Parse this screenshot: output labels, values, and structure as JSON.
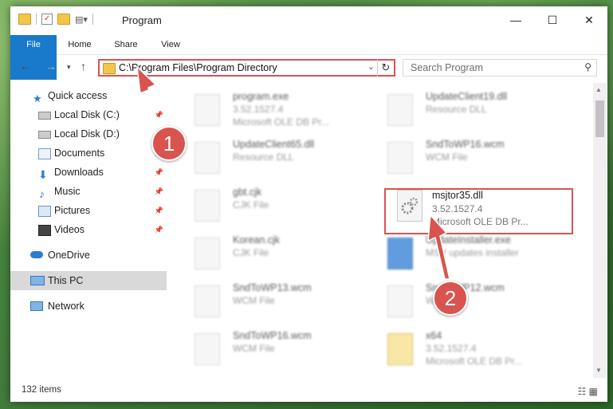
{
  "window": {
    "title": "Program",
    "minimize": "—",
    "maximize": "☐",
    "close": "✕"
  },
  "ribbon": {
    "tabs": [
      "File",
      "Home",
      "Share",
      "View"
    ]
  },
  "address": {
    "path": "C:\\Program Files\\Program Directory"
  },
  "search": {
    "placeholder": "Search Program"
  },
  "nav_pane": {
    "items": [
      {
        "label": "Quick access",
        "icon": "star-icon"
      },
      {
        "label": "Local Disk (C:)",
        "icon": "drive-icon"
      },
      {
        "label": "Local Disk (D:)",
        "icon": "drive-icon"
      },
      {
        "label": "Documents",
        "icon": "documents-icon"
      },
      {
        "label": "Downloads",
        "icon": "download-icon"
      },
      {
        "label": "Music",
        "icon": "music-icon"
      },
      {
        "label": "Pictures",
        "icon": "pictures-icon"
      },
      {
        "label": "Videos",
        "icon": "videos-icon"
      },
      {
        "label": "OneDrive",
        "icon": "cloud-icon"
      },
      {
        "label": "This PC",
        "icon": "computer-icon"
      },
      {
        "label": "Network",
        "icon": "network-icon"
      }
    ]
  },
  "files": [
    {
      "name": "program.exe",
      "line1": "3.52.1527.4",
      "line2": "Microsoft OLE DB Pr..."
    },
    {
      "name": "UpdateClient19.dll",
      "line1": "Resource DLL",
      "line2": ""
    },
    {
      "name": "UpdateClient65.dll",
      "line1": "Resource DLL",
      "line2": ""
    },
    {
      "name": "SndToWP16.wcm",
      "line1": "WCM File",
      "line2": ""
    },
    {
      "name": "gbt.cjk",
      "line1": "CJK File",
      "line2": ""
    },
    {
      "name": "msjtor35.dll",
      "line1": "3.52.1527.4",
      "line2": "Microsoft OLE DB Pr..."
    },
    {
      "name": "Korean.cjk",
      "line1": "CJK File",
      "line2": ""
    },
    {
      "name": "UpdateInstaller.exe",
      "line1": "MSV updates installer",
      "line2": ""
    },
    {
      "name": "SndToWP13.wcm",
      "line1": "WCM File",
      "line2": ""
    },
    {
      "name": "SndToWP12.wcm",
      "line1": "WCM File",
      "line2": ""
    },
    {
      "name": "SndToWP16.wcm",
      "line1": "WCM File",
      "line2": ""
    },
    {
      "name": "x64",
      "line1": "3.52.1527.4",
      "line2": "Microsoft OLE DB Pr..."
    }
  ],
  "status": {
    "item_count": "132 items"
  },
  "callouts": [
    "1",
    "2"
  ],
  "colors": {
    "accent": "#1979ca",
    "highlight": "#d9534f"
  }
}
